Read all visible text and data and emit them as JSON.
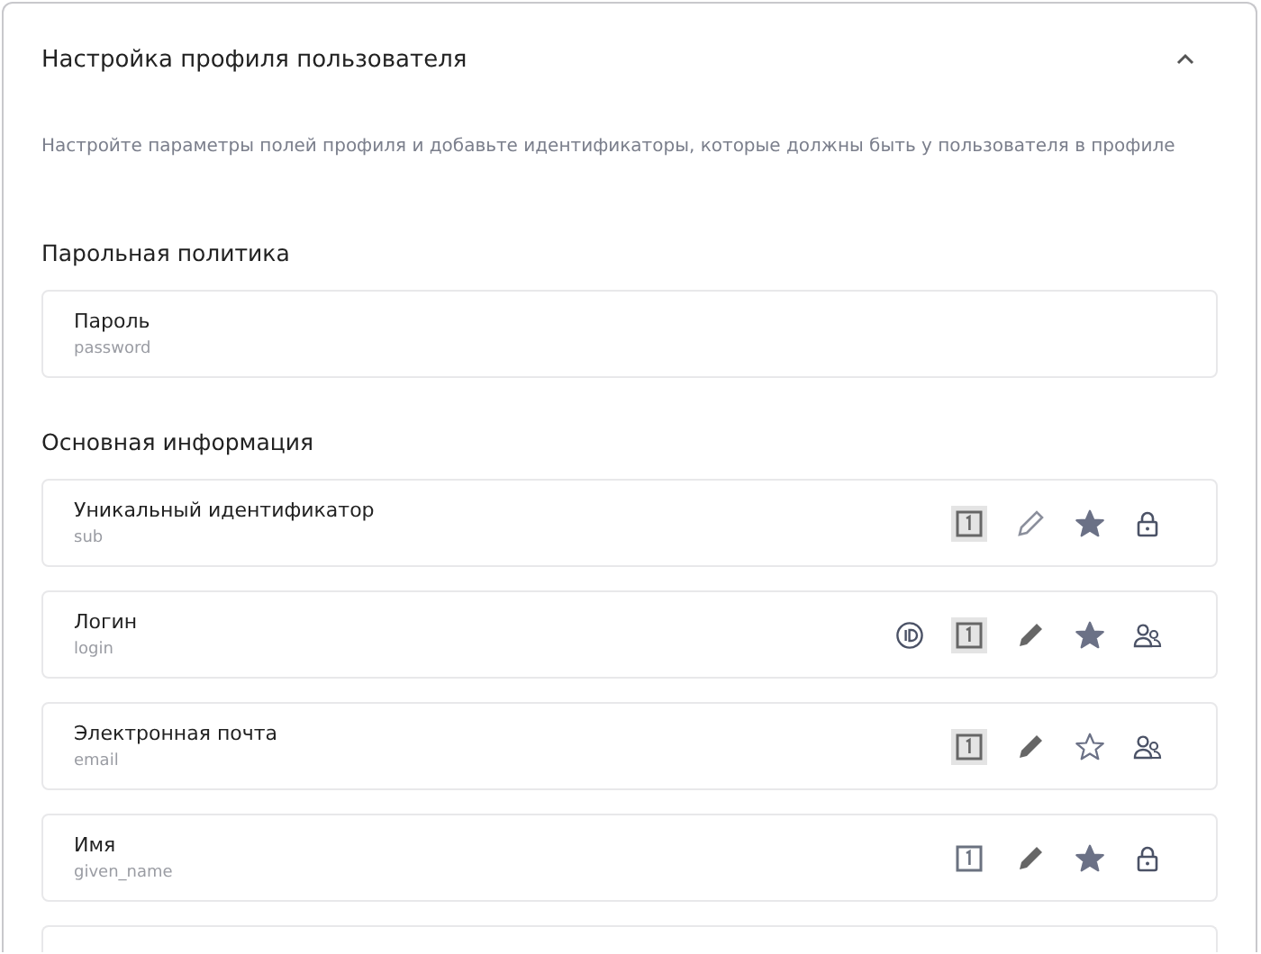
{
  "panel": {
    "title": "Настройка профиля пользователя",
    "expanded": true,
    "description": "Настройте параметры полей профиля и добавьте идентификаторы, которые должны быть у пользователя в профиле"
  },
  "sections": [
    {
      "title": "Парольная политика",
      "fields": [
        {
          "label": "Пароль",
          "key": "password"
        }
      ]
    },
    {
      "title": "Основная информация",
      "fields": [
        {
          "label": "Уникальный идентификатор",
          "key": "sub",
          "icons": [
            {
              "kind": "unique",
              "selected": true
            },
            {
              "kind": "edit",
              "disabled": true
            },
            {
              "kind": "star",
              "on": true
            },
            {
              "kind": "lock"
            }
          ]
        },
        {
          "label": "Логин",
          "key": "login",
          "icons": [
            {
              "kind": "id"
            },
            {
              "kind": "unique",
              "selected": true
            },
            {
              "kind": "edit",
              "disabled": false
            },
            {
              "kind": "star",
              "on": true
            },
            {
              "kind": "users"
            }
          ]
        },
        {
          "label": "Электронная почта",
          "key": "email",
          "icons": [
            {
              "kind": "unique",
              "selected": true
            },
            {
              "kind": "edit",
              "disabled": false
            },
            {
              "kind": "star",
              "on": false
            },
            {
              "kind": "users"
            }
          ]
        },
        {
          "label": "Имя",
          "key": "given_name",
          "icons": [
            {
              "kind": "unique",
              "selected": false
            },
            {
              "kind": "edit",
              "disabled": false
            },
            {
              "kind": "star",
              "on": true
            },
            {
              "kind": "lock"
            }
          ]
        },
        {
          "partial": true
        }
      ]
    }
  ]
}
